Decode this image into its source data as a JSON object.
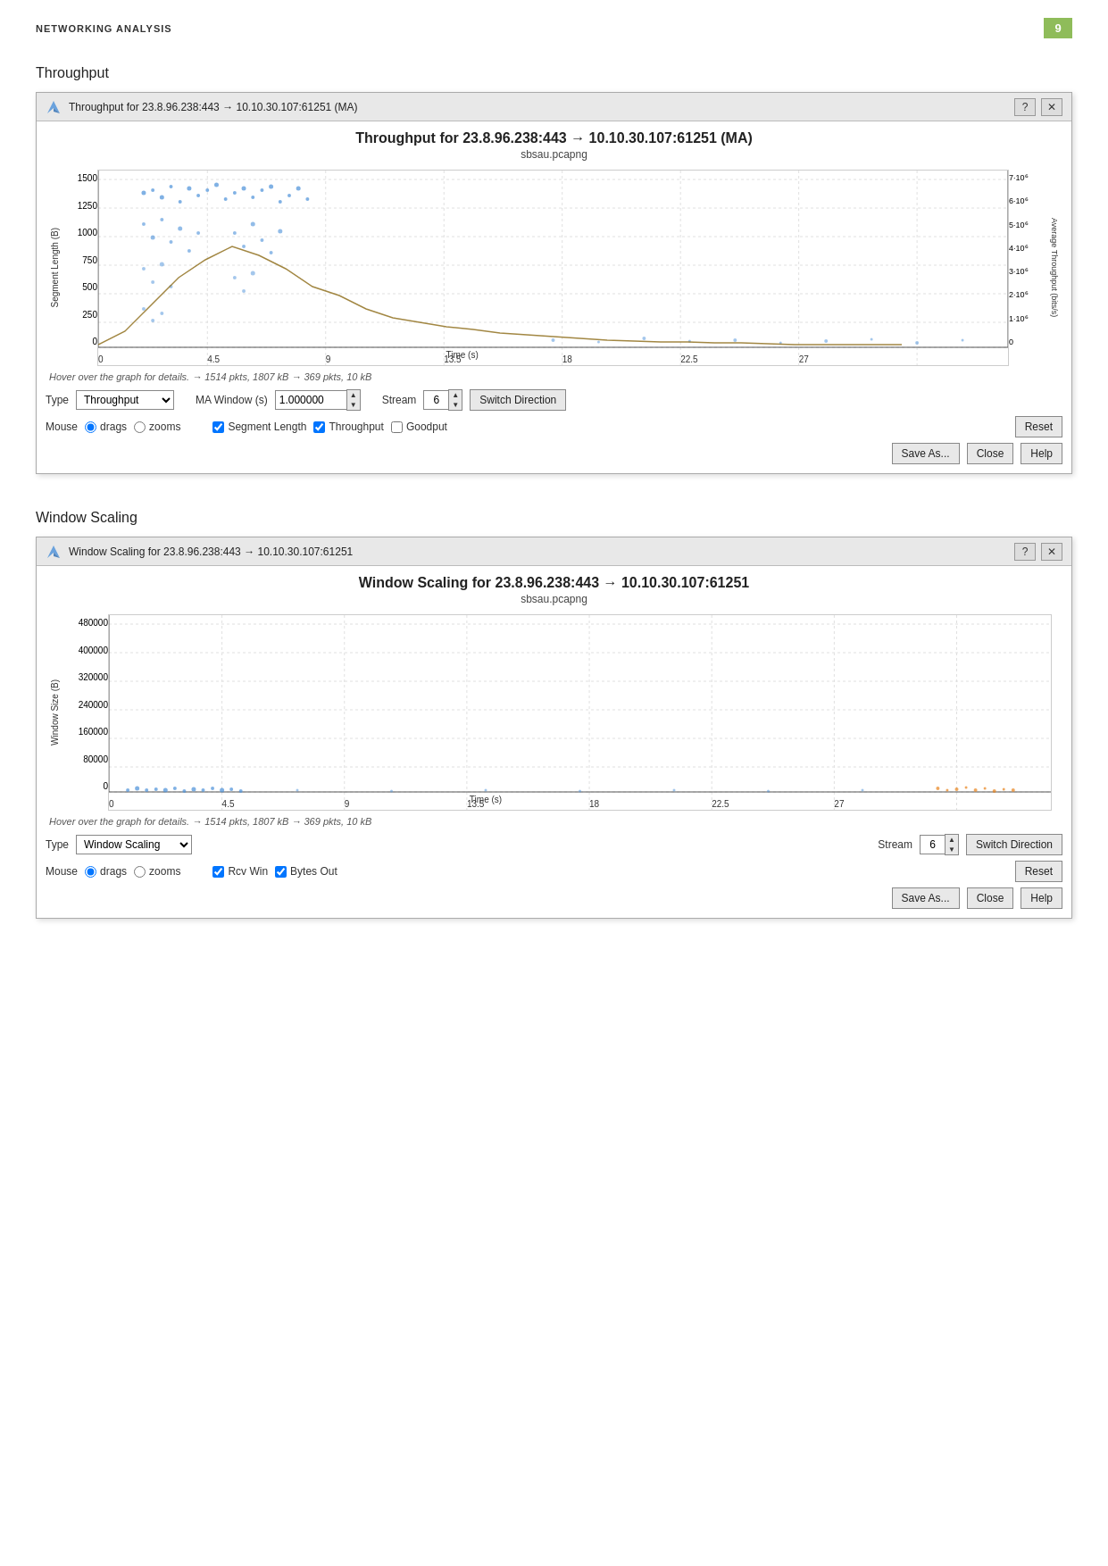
{
  "page": {
    "title": "NETWORKING ANALYSIS",
    "number": "9"
  },
  "throughput_section": {
    "label": "Throughput",
    "window": {
      "title": "Throughput for 23.8.96.238:443 → 10.10.30.107:61251 (MA)",
      "chart_title": "Throughput for 23.8.96.238:443 → 10.10.30.107:61251 (MA)",
      "chart_subtitle": "sbsau.pcapng",
      "hover_info": "Hover over the graph for details. → 1514 pkts, 1807 kB → 369 pkts, 10 kB",
      "y_axis_label": "Segment Length (B)",
      "y_axis_right_label": "Average Throughput (bits/s)",
      "x_axis_label": "Time (s)",
      "y_ticks": [
        "0",
        "250",
        "500",
        "750",
        "1000",
        "1250",
        "1500"
      ],
      "y_ticks_right": [
        "0",
        "1·10⁶",
        "2·10⁶",
        "3·10⁶",
        "4·10⁶",
        "5·10⁶",
        "6·10⁶",
        "7·10⁶"
      ],
      "x_ticks": [
        "0",
        "4.5",
        "9",
        "13.5",
        "18",
        "22.5",
        "27"
      ],
      "type_label": "Type",
      "type_value": "Throughput",
      "ma_window_label": "MA Window (s)",
      "ma_window_value": "1.000000",
      "stream_label": "Stream",
      "stream_value": "6",
      "switch_direction_label": "Switch Direction",
      "mouse_label": "Mouse",
      "drags_label": "drags",
      "zooms_label": "zooms",
      "segment_length_label": "Segment Length",
      "throughput_label": "Throughput",
      "goodput_label": "Goodput",
      "reset_label": "Reset",
      "save_as_label": "Save As...",
      "close_label": "Close",
      "help_label": "Help"
    }
  },
  "window_scaling_section": {
    "label": "Window Scaling",
    "window": {
      "title": "Window Scaling for 23.8.96.238:443 → 10.10.30.107:61251",
      "chart_title": "Window Scaling for 23.8.96.238:443 → 10.10.30.107:61251",
      "chart_subtitle": "sbsau.pcapng",
      "hover_info": "Hover over the graph for details. → 1514 pkts, 1807 kB → 369 pkts, 10 kB",
      "y_axis_label": "Window Size (B)",
      "x_axis_label": "Time (s)",
      "y_ticks": [
        "0",
        "80000",
        "160000",
        "240000",
        "320000",
        "400000",
        "480000"
      ],
      "x_ticks": [
        "0",
        "4.5",
        "9",
        "13.5",
        "18",
        "22.5",
        "27"
      ],
      "type_label": "Type",
      "type_value": "Window Scaling",
      "stream_label": "Stream",
      "stream_value": "6",
      "switch_direction_label": "Switch Direction",
      "mouse_label": "Mouse",
      "drags_label": "drags",
      "zooms_label": "zooms",
      "rcv_win_label": "Rcv Win",
      "bytes_out_label": "Bytes Out",
      "reset_label": "Reset",
      "save_as_label": "Save As...",
      "close_label": "Close",
      "help_label": "Help"
    }
  }
}
